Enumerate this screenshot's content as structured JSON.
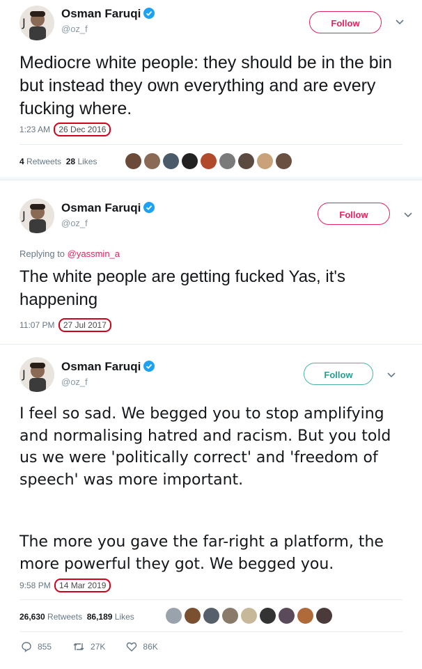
{
  "tweets": [
    {
      "author": "Osman Faruqi",
      "handle": "@oz_f",
      "follow_label": "Follow",
      "text": "Mediocre white people: they should be in the bin but instead they own everything and are every fucking where.",
      "time": "1:23 AM",
      "date": "26 Dec 2016",
      "retweets": "4",
      "retweets_label": "Retweets",
      "likes": "28",
      "likes_label": "Likes",
      "liker_colors": [
        "#6b4a3a",
        "#8a6a55",
        "#4b5a6a",
        "#222222",
        "#b04a2a",
        "#7a7a7a",
        "#5a4a40",
        "#c9a27a",
        "#6a5040"
      ]
    },
    {
      "author": "Osman Faruqi",
      "handle": "@oz_f",
      "follow_label": "Follow",
      "replying_prefix": "Replying to",
      "replying_to": "@yassmin_a",
      "text": "The white people are getting fucked Yas, it's happening",
      "time": "11:07 PM",
      "date": "27 Jul 2017"
    },
    {
      "author": "Osman Faruqi",
      "handle": "@oz_f",
      "follow_label": "Follow",
      "text_p1": "I feel so sad. We begged you to stop amplifying and normalising hatred and racism. But you told us we were 'politically correct' and 'freedom of speech' was more important.",
      "text_p2": "The more you gave the far-right a platform, the more powerful they got. We begged you.",
      "time": "9:58 PM",
      "date": "14 Mar 2019",
      "retweets": "26,630",
      "retweets_label": "Retweets",
      "likes": "86,189",
      "likes_label": "Likes",
      "liker_colors": [
        "#9aa3ab",
        "#7a5030",
        "#55606a",
        "#8a7a6a",
        "#c8b89a",
        "#333333",
        "#5a4a5a",
        "#b06a3a",
        "#4a3a3a"
      ],
      "reply_count": "855",
      "retweet_count": "27K",
      "like_count": "86K"
    }
  ],
  "colors": {
    "follow_pink": "#e0245e",
    "follow_teal": "#2a9d8f",
    "circle_red": "#d0021b",
    "verified_blue": "#1da1f2"
  }
}
